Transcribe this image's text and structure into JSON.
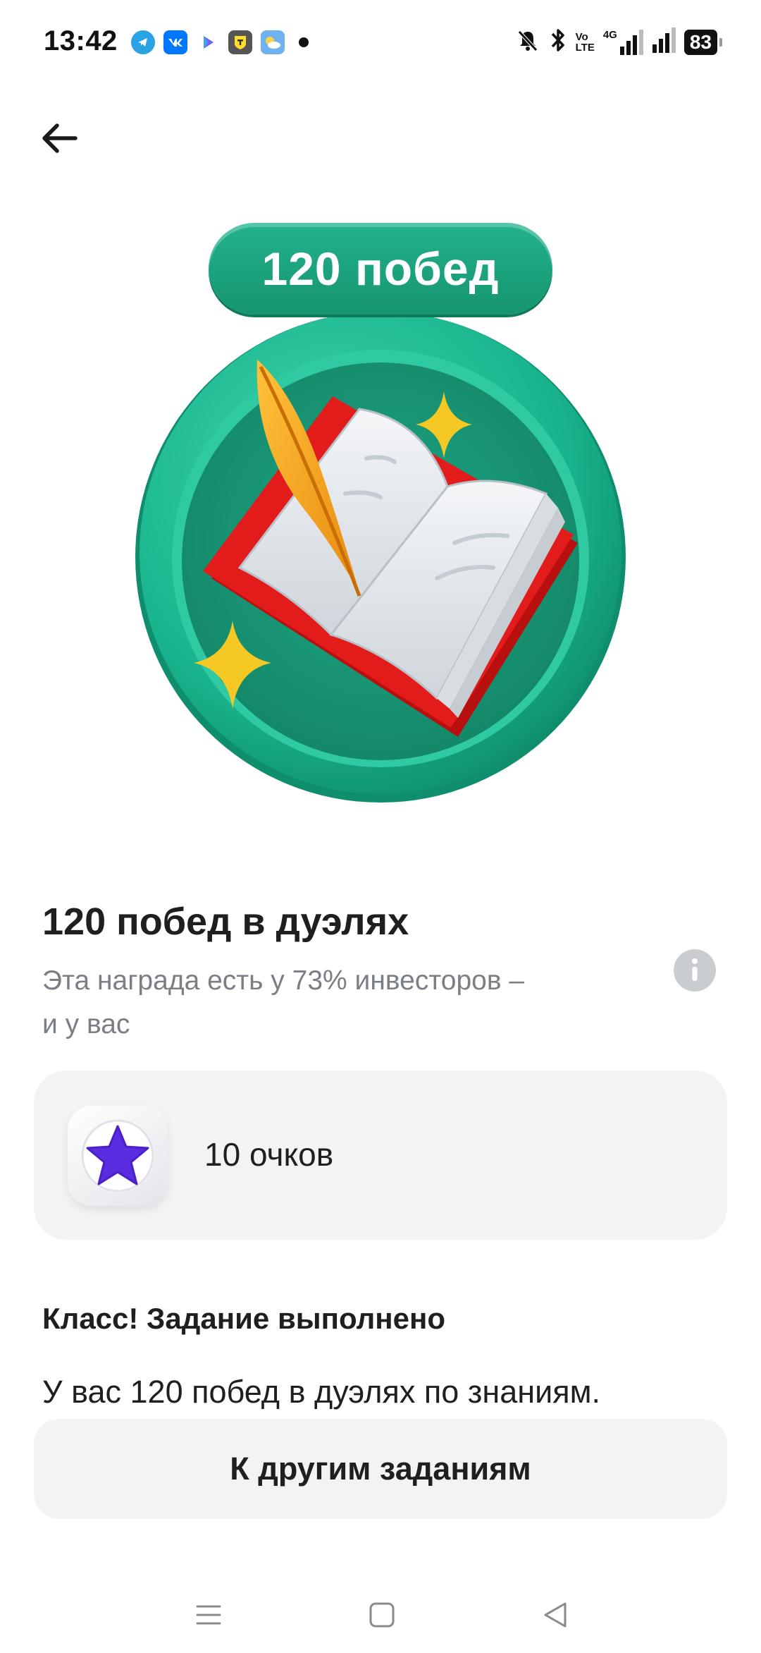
{
  "status_bar": {
    "time": "13:42",
    "net_top": "Vo",
    "net_bottom": "LTE",
    "net_gen": "4G",
    "battery": "83"
  },
  "badge": {
    "label": "120 побед",
    "colors": {
      "ring": "#1fb893",
      "book_cover": "#d41a1a",
      "feather": "#f3a41c",
      "sparkle": "#f6c824"
    }
  },
  "achievement": {
    "title": "120 побед в дуэлях",
    "description": "Эта награда есть у 73% инвесторов –",
    "description_line2": "и у вас"
  },
  "reward": {
    "points": "10 очков",
    "icon": "star-icon",
    "icon_color": "#5a2ee0"
  },
  "completion": {
    "title": "Класс! Задание выполнено",
    "text": "У вас 120 побед в дуэлях по знаниям."
  },
  "buttons": {
    "other_tasks": "К другим заданиям"
  },
  "nav": {
    "icons": [
      "menu-icon",
      "home-square-icon",
      "back-triangle-icon"
    ]
  }
}
